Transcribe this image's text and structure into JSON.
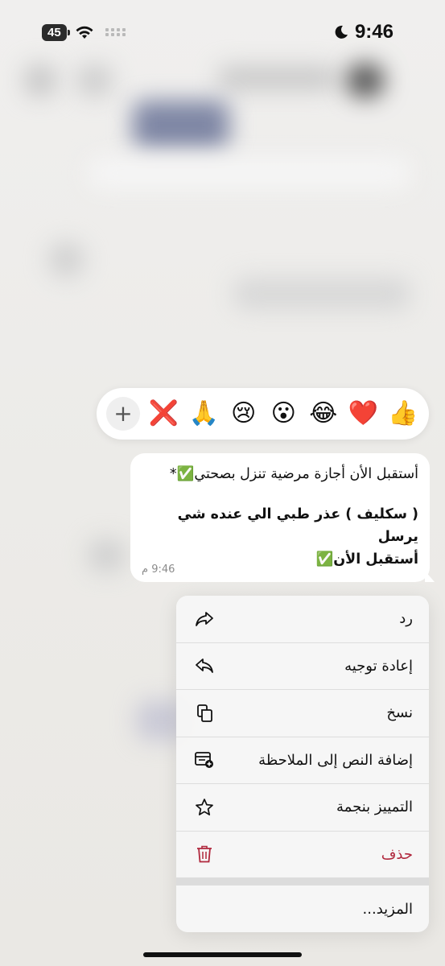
{
  "status_bar": {
    "battery": "45",
    "time": "9:46"
  },
  "reactions": {
    "add_symbol": "+",
    "emojis": [
      "❌",
      "🙏",
      "😢",
      "😮",
      "😂",
      "❤️",
      "👍"
    ]
  },
  "message": {
    "line1": "أستقبل الأن أجازة مرضية تنزل بصحتي✅*",
    "line2": "( سكليف ) عذر طبي الي عنده شي يرسل",
    "line3": "أستقبل الأن✅",
    "time": "9:46 م"
  },
  "menu": {
    "items": [
      {
        "label": "رد",
        "icon": "reply-icon"
      },
      {
        "label": "إعادة توجيه",
        "icon": "forward-icon"
      },
      {
        "label": "نسخ",
        "icon": "copy-icon"
      },
      {
        "label": "إضافة النص إلى الملاحظة",
        "icon": "add-note-icon"
      },
      {
        "label": "التمييز بنجمة",
        "icon": "star-icon"
      },
      {
        "label": "حذف",
        "icon": "trash-icon"
      }
    ],
    "more_label": "المزيد...",
    "danger_color": "#b0283d"
  }
}
